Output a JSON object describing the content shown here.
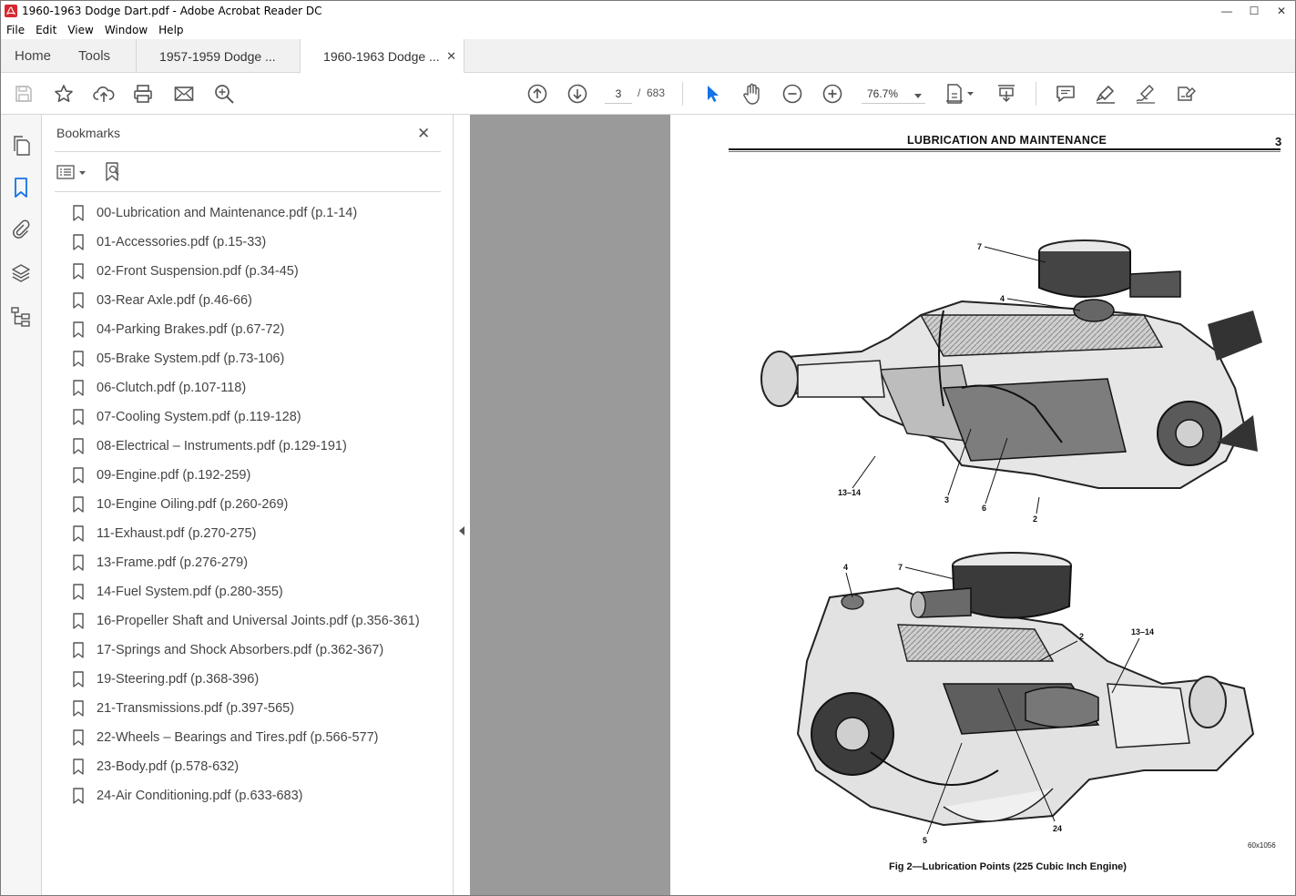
{
  "window": {
    "title": "1960-1963 Dodge Dart.pdf - Adobe Acrobat Reader DC",
    "controls": [
      "—",
      "☐",
      "✕"
    ]
  },
  "menu": [
    "File",
    "Edit",
    "View",
    "Window",
    "Help"
  ],
  "tabs": {
    "home": "Home",
    "tools": "Tools",
    "documents": [
      {
        "label": "1957-1959 Dodge ...",
        "active": false
      },
      {
        "label": "1960-1963 Dodge ...",
        "active": true
      }
    ],
    "close_glyph": "✕"
  },
  "toolbar": {
    "page_current": "3",
    "page_separator": "/",
    "page_total": "683",
    "zoom": "76.7%",
    "left_icons": [
      "save-icon",
      "star-icon",
      "upload-icon",
      "print-icon",
      "mail-icon",
      "search-zoom-icon"
    ],
    "nav_icons": [
      "page-up-icon",
      "page-down-icon"
    ],
    "right_icons": [
      "select-arrow-icon",
      "hand-icon",
      "zoom-out-icon",
      "zoom-in-icon",
      "page-fit-icon",
      "scroll-mode-icon",
      "comment-icon",
      "highlight-icon",
      "sign-icon",
      "fill-sign-icon"
    ],
    "accent": "#1473e6"
  },
  "rail_icons": [
    "pages-icon",
    "bookmark-icon",
    "attachment-icon",
    "layers-icon",
    "structure-icon"
  ],
  "bookmarks": {
    "title": "Bookmarks",
    "close": "✕",
    "items": [
      "00-Lubrication and Maintenance.pdf (p.1-14)",
      "01-Accessories.pdf (p.15-33)",
      "02-Front Suspension.pdf (p.34-45)",
      "03-Rear Axle.pdf (p.46-66)",
      "04-Parking Brakes.pdf (p.67-72)",
      "05-Brake System.pdf (p.73-106)",
      "06-Clutch.pdf (p.107-118)",
      "07-Cooling System.pdf (p.119-128)",
      "08-Electrical – Instruments.pdf (p.129-191)",
      "09-Engine.pdf (p.192-259)",
      "10-Engine Oiling.pdf (p.260-269)",
      "11-Exhaust.pdf (p.270-275)",
      "13-Frame.pdf (p.276-279)",
      "14-Fuel System.pdf (p.280-355)",
      "16-Propeller Shaft and Universal Joints.pdf (p.356-361)",
      "17-Springs and Shock Absorbers.pdf (p.362-367)",
      "19-Steering.pdf (p.368-396)",
      "21-Transmissions.pdf (p.397-565)",
      "22-Wheels – Bearings and Tires.pdf (p.566-577)",
      "23-Body.pdf (p.578-632)",
      "24-Air Conditioning.pdf (p.633-683)"
    ]
  },
  "document": {
    "header": "LUBRICATION  AND  MAINTENANCE",
    "page_number": "3",
    "figure_code": "60x1056",
    "caption": "Fig  2—Lubrication Points (225 Cubic Inch Engine)",
    "callouts_top": [
      "7",
      "4",
      "13–14",
      "3",
      "6",
      "2"
    ],
    "callouts_bottom": [
      "4",
      "7",
      "2",
      "13–14",
      "5",
      "24"
    ]
  }
}
